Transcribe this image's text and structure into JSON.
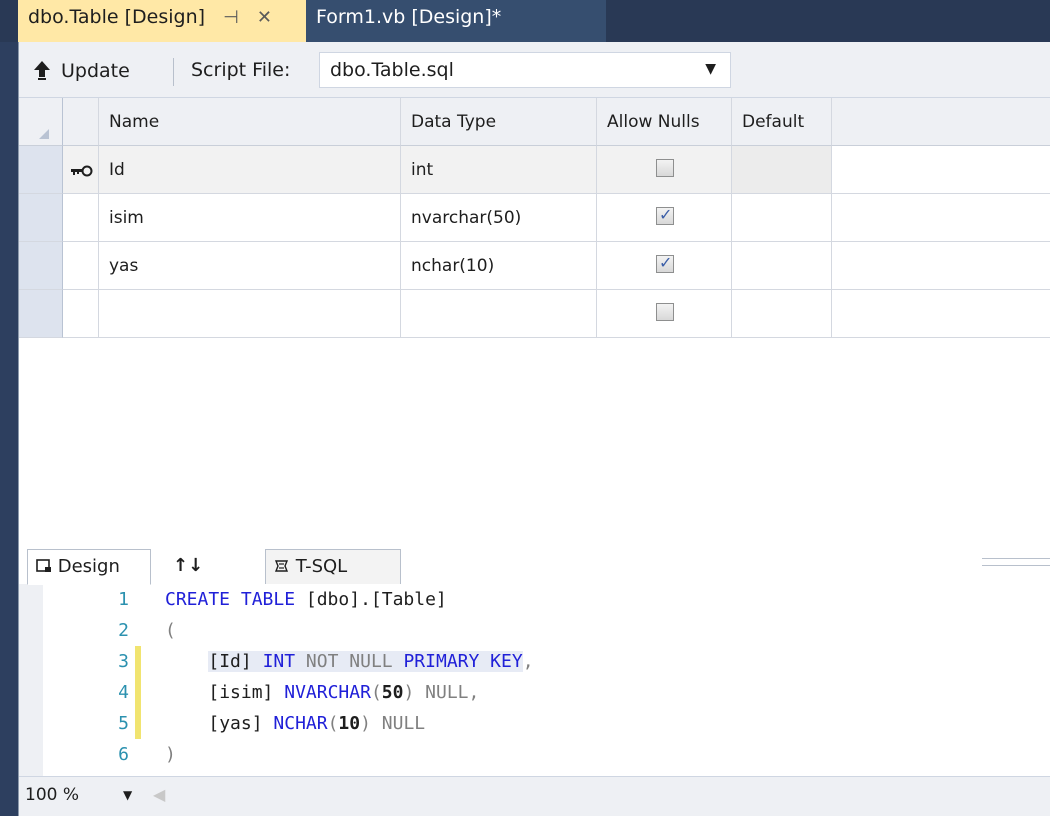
{
  "doc_tabs": {
    "active": {
      "label": "dbo.Table [Design]",
      "pin": "⊣",
      "close": "✕"
    },
    "inactive": {
      "label": "Form1.vb [Design]*"
    }
  },
  "toolbar": {
    "update_label": "Update",
    "script_file_label": "Script File:",
    "script_file_value": "dbo.Table.sql"
  },
  "grid": {
    "headers": {
      "name": "Name",
      "data_type": "Data Type",
      "allow_nulls": "Allow Nulls",
      "default": "Default"
    },
    "rows": [
      {
        "name": "Id",
        "data_type": "int",
        "allow_nulls": false,
        "default": "",
        "primary_key": true
      },
      {
        "name": "isim",
        "data_type": "nvarchar(50)",
        "allow_nulls": true,
        "default": "",
        "primary_key": false
      },
      {
        "name": "yas",
        "data_type": "nchar(10)",
        "allow_nulls": true,
        "default": "",
        "primary_key": false
      },
      {
        "name": "",
        "data_type": "",
        "allow_nulls": false,
        "default": "",
        "primary_key": false
      }
    ]
  },
  "pane_tabs": {
    "design": "Design",
    "swap": "↑↓",
    "tsql": "T-SQL"
  },
  "editor": {
    "lines": [
      {
        "num": "1",
        "changed": false
      },
      {
        "num": "2",
        "changed": false
      },
      {
        "num": "3",
        "changed": true
      },
      {
        "num": "4",
        "changed": true
      },
      {
        "num": "5",
        "changed": true
      },
      {
        "num": "6",
        "changed": false
      }
    ],
    "tokens": {
      "l1_kw": "CREATE TABLE",
      "l1_rest": " [dbo].[Table]",
      "l2": "(",
      "l3_id": "[Id]",
      "l3_type": "INT",
      "l3_notnull": "NOT NULL",
      "l3_pk": "PRIMARY KEY",
      "l3_comma": ",",
      "l4_col": "[isim]",
      "l4_type": "NVARCHAR",
      "l4_open": "(",
      "l4_len": "50",
      "l4_close": ")",
      "l4_null": "NULL,",
      "l5_col": "[yas]",
      "l5_type": "NCHAR",
      "l5_open": "(",
      "l5_len": "10",
      "l5_close": ")",
      "l5_null": "NULL",
      "l6": ")"
    }
  },
  "zoom": {
    "value": "100 %"
  },
  "colors": {
    "accent_tab": "#ffe8a6",
    "keyword": "#2020d8",
    "change_marker": "#f1e470"
  }
}
